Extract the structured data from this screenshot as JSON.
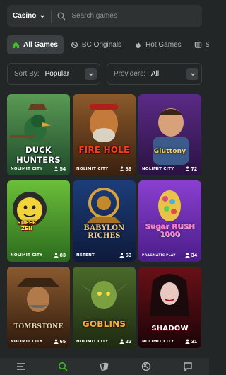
{
  "header": {
    "category_select": "Casino",
    "search_placeholder": "Search games"
  },
  "tabs": [
    {
      "label": "All Games",
      "icon": "home-icon",
      "active": true
    },
    {
      "label": "BC Originals",
      "icon": "bc-originals-icon",
      "active": false
    },
    {
      "label": "Hot Games",
      "icon": "flame-icon",
      "active": false
    },
    {
      "label": "Sl",
      "icon": "slots-icon",
      "active": false
    }
  ],
  "filters": {
    "sort_label": "Sort By:",
    "sort_value": "Popular",
    "providers_label": "Providers:",
    "providers_value": "All"
  },
  "games": [
    {
      "title": "DUCK HUNTERS",
      "provider": "NOLIMIT CITY",
      "players": "54"
    },
    {
      "title": "FIRE HOLE",
      "provider": "NOLIMIT CITY",
      "players": "89"
    },
    {
      "title": "Gluttony",
      "provider": "NOLIMIT CITY",
      "players": "72"
    },
    {
      "title": "SUPER ZEN",
      "provider": "NOLIMIT CITY",
      "players": "83"
    },
    {
      "title": "BABYLON RICHES",
      "provider": "NETENT",
      "players": "63"
    },
    {
      "title": "Sugar RUSH 1000",
      "provider": "PRAGMATIC PLAY",
      "players": "34"
    },
    {
      "title": "TOMBSTONE",
      "provider": "NOLIMIT CITY",
      "players": "65"
    },
    {
      "title": "GOBLINS",
      "provider": "NOLIMIT CITY",
      "players": "22"
    },
    {
      "title": "SHADOW",
      "provider": "NOLIMIT CITY",
      "players": "31"
    }
  ],
  "bottom_nav": [
    {
      "icon": "menu-icon"
    },
    {
      "icon": "casino-search-icon",
      "active": true
    },
    {
      "icon": "cards-icon"
    },
    {
      "icon": "sports-ball-icon"
    },
    {
      "icon": "chat-icon"
    }
  ],
  "colors": {
    "background": "#232626",
    "panel": "#2e3233",
    "accent_green": "#3bc117"
  }
}
